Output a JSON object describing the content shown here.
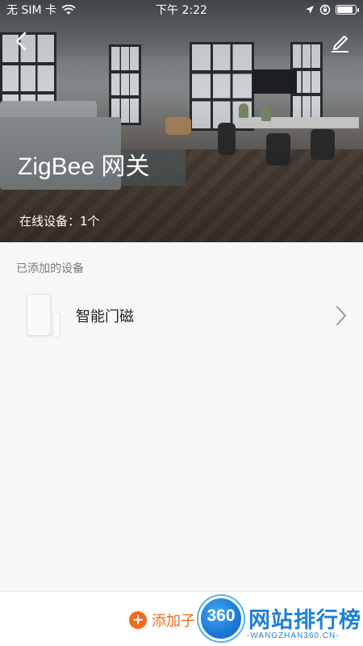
{
  "status_bar": {
    "carrier": "无 SIM 卡",
    "time": "下午 2:22"
  },
  "header": {
    "title": "ZigBee 网关",
    "online_devices": "在线设备：1个"
  },
  "devices_section": {
    "label": "已添加的设备",
    "items": [
      {
        "name": "智能门磁"
      }
    ]
  },
  "bottom": {
    "add_label": "添加子"
  },
  "watermark": {
    "number": "360",
    "cn": "网站排行榜",
    "en": "-WANGZHAN360.CN-"
  },
  "colors": {
    "accent": "#ef6b1e",
    "watermark_blue": "#1d7fd8"
  }
}
